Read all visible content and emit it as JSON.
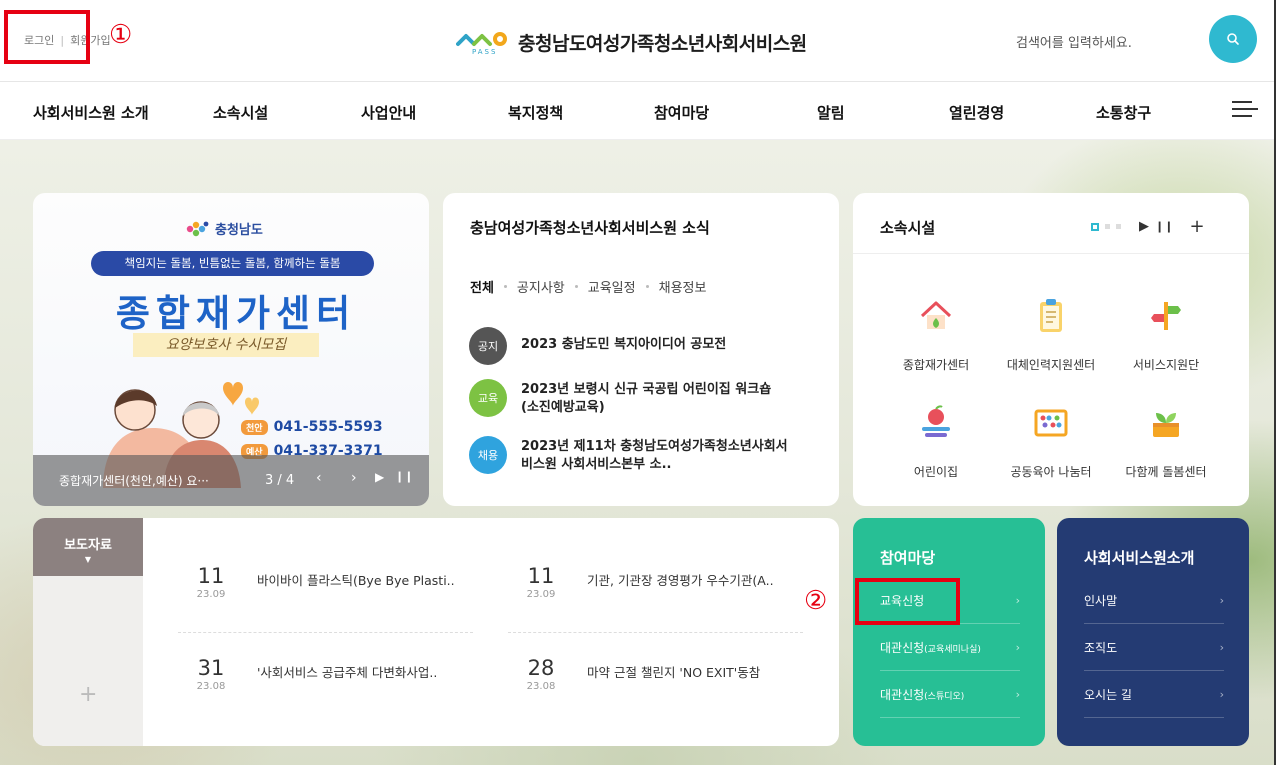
{
  "header": {
    "login": "로그인",
    "signup": "회원가입",
    "logo_text": "충청남도여성가족청소년사회서비스원",
    "logo_sub": "PASS",
    "search_placeholder": "검색어를 입력하세요."
  },
  "annotations": {
    "mark1": "①",
    "mark2": "②"
  },
  "nav": [
    "사회서비스원 소개",
    "소속시설",
    "사업안내",
    "복지정책",
    "참여마당",
    "알림",
    "열린경영",
    "소통창구"
  ],
  "banner": {
    "org": "충청남도",
    "slogan": "책임지는 돌봄, 빈틈없는 돌봄, 함께하는 돌봄",
    "title": "종합재가센터",
    "subtitle": "요양보호사 수시모집",
    "phone1_tag": "천안",
    "phone1": "041-555-5593",
    "phone2_tag": "예산",
    "phone2": "041-337-3371",
    "caption": "종합재가센터(천안,예산) 요···",
    "counter": "3 / 4"
  },
  "news": {
    "title": "충남여성가족청소년사회서비스원 소식",
    "tabs": [
      "전체",
      "공지사항",
      "교육일정",
      "채용정보"
    ],
    "items": [
      {
        "badge": "공지",
        "text": "2023 충남도민 복지아이디어 공모전"
      },
      {
        "badge": "교육",
        "text": "2023년 보령시 신규 국공립 어린이집 워크숍(소진예방교육)"
      },
      {
        "badge": "채용",
        "text": "2023년 제11차 충청남도여성가족청소년사회서비스원 사회서비스본부 소.."
      }
    ]
  },
  "facilities": {
    "title": "소속시설",
    "items": [
      "종합재가센터",
      "대체인력지원센터",
      "서비스지원단",
      "어린이집",
      "공동육아 나눔터",
      "다함께 돌봄센터"
    ]
  },
  "press": {
    "tab": "보도자료",
    "items": [
      {
        "day": "11",
        "month": "23.09",
        "text": "바이바이 플라스틱(Bye Bye Plasti.."
      },
      {
        "day": "11",
        "month": "23.09",
        "text": "기관, 기관장 경영평가 우수기관(A.."
      },
      {
        "day": "31",
        "month": "23.08",
        "text": "'사회서비스 공급주체 다변화사업.."
      },
      {
        "day": "28",
        "month": "23.08",
        "text": "마약 근절 챌린지 'NO EXIT'동참"
      }
    ]
  },
  "participation": {
    "title": "참여마당",
    "item1": "교육신청",
    "item2": "대관신청",
    "item2_sub": "(교육세미나실)",
    "item3": "대관신청",
    "item3_sub": "(스튜디오)"
  },
  "intro": {
    "title": "사회서비스원소개",
    "items": [
      "인사말",
      "조직도",
      "오시는 길"
    ]
  },
  "colors": {
    "accent": "#2fb9d0",
    "participation_bg": "#27bf95",
    "intro_bg": "#243b73",
    "highlight": "#e60012"
  }
}
